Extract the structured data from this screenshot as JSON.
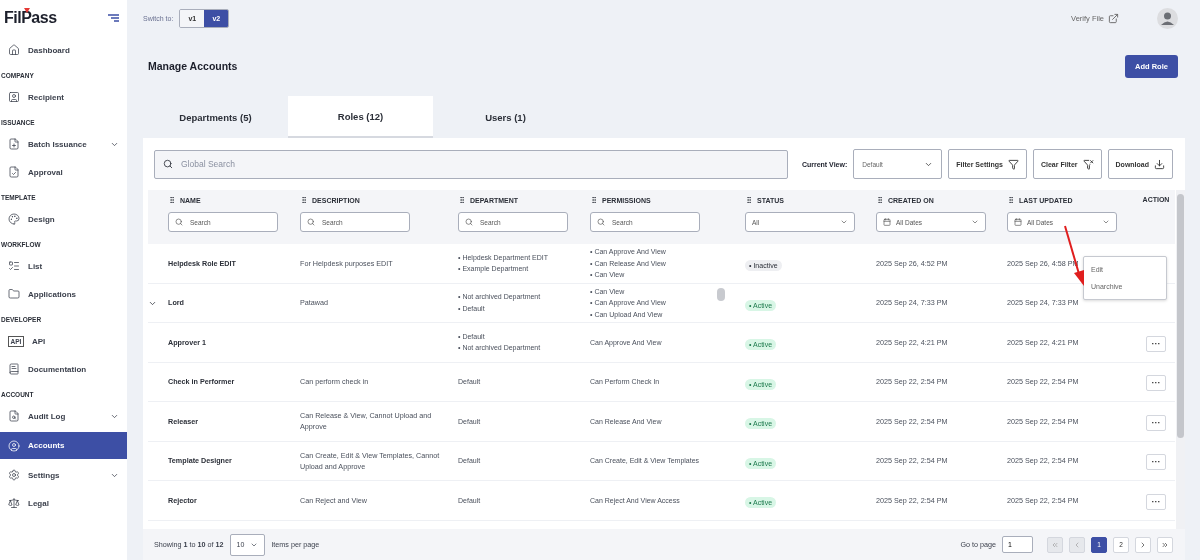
{
  "logo": {
    "text": "FilPass"
  },
  "sidebar": [
    {
      "kind": "item",
      "label": "Dashboard",
      "selected": false
    },
    {
      "kind": "section",
      "label": "COMPANY"
    },
    {
      "kind": "item",
      "label": "Recipient",
      "selected": false
    },
    {
      "kind": "section",
      "label": "ISSUANCE"
    },
    {
      "kind": "item",
      "label": "Batch Issuance",
      "selected": false,
      "expandable": true
    },
    {
      "kind": "item",
      "label": "Approval",
      "selected": false
    },
    {
      "kind": "section",
      "label": "TEMPLATE"
    },
    {
      "kind": "item",
      "label": "Design",
      "selected": false
    },
    {
      "kind": "section",
      "label": "WORKFLOW"
    },
    {
      "kind": "item",
      "label": "List",
      "selected": false
    },
    {
      "kind": "item",
      "label": "Applications",
      "selected": false
    },
    {
      "kind": "section",
      "label": "DEVELOPER"
    },
    {
      "kind": "item",
      "label": "API",
      "selected": false,
      "icon_text": "API"
    },
    {
      "kind": "item",
      "label": "Documentation",
      "selected": false
    },
    {
      "kind": "section",
      "label": "ACCOUNT"
    },
    {
      "kind": "item",
      "label": "Audit Log",
      "selected": false,
      "expandable": true
    },
    {
      "kind": "item",
      "label": "Accounts",
      "selected": true
    },
    {
      "kind": "item",
      "label": "Settings",
      "selected": false,
      "expandable": true
    },
    {
      "kind": "item",
      "label": "Legal",
      "selected": false
    }
  ],
  "topbar": {
    "switch_label": "Switch to:",
    "versions": [
      {
        "label": "v1",
        "selected": false
      },
      {
        "label": "v2",
        "selected": true
      }
    ],
    "verify_link": "Verify File"
  },
  "page_title": "Manage Accounts",
  "add_button": "Add Role",
  "tabs": [
    {
      "label": "Departments (5)",
      "selected": false
    },
    {
      "label": "Roles (12)",
      "selected": true
    },
    {
      "label": "Users (1)",
      "selected": false
    }
  ],
  "toolbar": {
    "search_placeholder": "Global Search",
    "view_label": "Current View:",
    "view_value": "Default",
    "buttons": [
      {
        "label": "Filter Settings",
        "kind": "filter-settings"
      },
      {
        "label": "Clear Filter",
        "kind": "clear-filter"
      },
      {
        "label": "Download",
        "kind": "download"
      }
    ]
  },
  "columns": [
    {
      "label": "NAME",
      "draggable": true,
      "filter": {
        "kind": "search",
        "placeholder": "Search"
      }
    },
    {
      "label": "DESCRIPTION",
      "draggable": true,
      "filter": {
        "kind": "search",
        "placeholder": "Search"
      }
    },
    {
      "label": "DEPARTMENT",
      "draggable": true,
      "filter": {
        "kind": "search",
        "placeholder": "Search"
      }
    },
    {
      "label": "PERMISSIONS",
      "draggable": true,
      "filter": {
        "kind": "search",
        "placeholder": "Search"
      }
    },
    {
      "label": "STATUS",
      "draggable": true,
      "filter": {
        "kind": "select",
        "value": "All"
      }
    },
    {
      "label": "CREATED ON",
      "draggable": true,
      "filter": {
        "kind": "date",
        "value": "All Dates"
      }
    },
    {
      "label": "LAST UPDATED",
      "draggable": true,
      "filter": {
        "kind": "date",
        "value": "All Dates"
      }
    },
    {
      "label": "ACTION",
      "draggable": false
    }
  ],
  "rows": [
    {
      "expandable": false,
      "name": "Helpdesk Role EDIT",
      "description": "For Helpdesk purposes EDIT",
      "department": [
        "• Helpdesk Department EDIT",
        "• Example Department"
      ],
      "permissions": [
        "• Can Approve And View",
        "• Can Release And View",
        "• Can View"
      ],
      "status": {
        "label": "• Inactive",
        "kind": "inactive"
      },
      "created": "2025 Sep 26, 4:52 PM",
      "updated": "2025 Sep 26, 4:58 PM"
    },
    {
      "expandable": true,
      "name": "Lord",
      "description": "Patawad",
      "department": [
        "• Not archived Department",
        "• Default"
      ],
      "permissions": [
        "• Can View",
        "• Can Approve And View",
        "• Can Upload And View"
      ],
      "status": {
        "label": "• Active",
        "kind": "active"
      },
      "created": "2025 Sep 24, 7:33 PM",
      "updated": "2025 Sep 24, 7:33 PM"
    },
    {
      "expandable": false,
      "name": "Approver 1",
      "department": [
        "• Default",
        "• Not archived Department"
      ],
      "permissions": [
        "Can Approve And View"
      ],
      "status": {
        "label": "• Active",
        "kind": "active"
      },
      "created": "2025 Sep 22, 4:21 PM",
      "updated": "2025 Sep 22, 4:21 PM",
      "action": "···"
    },
    {
      "expandable": false,
      "name": "Check in Performer",
      "description": "Can perform check in",
      "department": [
        "Default"
      ],
      "permissions": [
        "Can Perform Check In"
      ],
      "status": {
        "label": "• Active",
        "kind": "active"
      },
      "created": "2025 Sep 22, 2:54 PM",
      "updated": "2025 Sep 22, 2:54 PM",
      "action": "···"
    },
    {
      "expandable": false,
      "name": "Releaser",
      "description": "Can Release & View, Cannot Upload and Approve",
      "department": [
        "Default"
      ],
      "permissions": [
        "Can Release And View"
      ],
      "status": {
        "label": "• Active",
        "kind": "active"
      },
      "created": "2025 Sep 22, 2:54 PM",
      "updated": "2025 Sep 22, 2:54 PM",
      "action": "···"
    },
    {
      "expandable": false,
      "name": "Template Designer",
      "description": "Can Create, Edit & View Templates, Cannot Upload and Approve",
      "department": [
        "Default"
      ],
      "permissions": [
        "Can Create, Edit & View Templates"
      ],
      "status": {
        "label": "• Active",
        "kind": "active"
      },
      "created": "2025 Sep 22, 2:54 PM",
      "updated": "2025 Sep 22, 2:54 PM",
      "action": "···"
    },
    {
      "expandable": false,
      "name": "Rejector",
      "description": "Can Reject and View",
      "department": [
        "Default"
      ],
      "permissions": [
        "Can Reject And View Access"
      ],
      "status": {
        "label": "• Active",
        "kind": "active"
      },
      "created": "2025 Sep 22, 2:54 PM",
      "updated": "2025 Sep 22, 2:54 PM",
      "action": "···"
    }
  ],
  "row_menu": {
    "items": [
      "Edit",
      "Unarchive"
    ]
  },
  "footer": {
    "showing": "Showing **1** to **10** of **12**",
    "page_size": "10",
    "page_size_label": "Items per page",
    "goto_label": "Go to page",
    "goto_value": "1",
    "pages": [
      {
        "label": "1",
        "selected": true
      },
      {
        "label": "2",
        "selected": false
      }
    ]
  }
}
